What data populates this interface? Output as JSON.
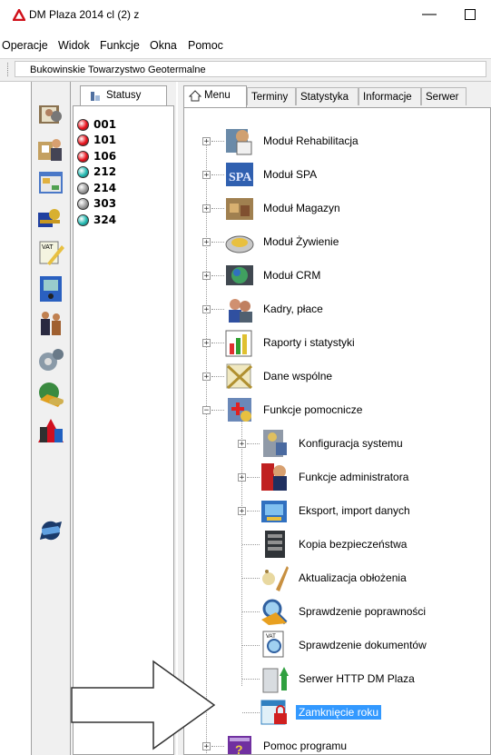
{
  "window": {
    "title": "DM Plaza 2014 cl (2) z",
    "minimize": "—"
  },
  "menu": [
    "Operacje",
    "Widok",
    "Funkcje",
    "Okna",
    "Pomoc"
  ],
  "toolbar": {
    "company": "Bukowinskie Towarzystwo Geotermalne"
  },
  "sidebar": {
    "icons": [
      "book-users-icon",
      "people-group-icon",
      "window-form-icon",
      "key-icon",
      "vat-pencil-icon",
      "phone-card-icon",
      "people-meeting-icon",
      "gears-icon",
      "globe-phone-icon",
      "dm-logo-icon",
      "sync-arrows-icon"
    ]
  },
  "status_panel": {
    "tab_label": "Statusy",
    "items": [
      {
        "code": "001",
        "color": "#e8101a"
      },
      {
        "code": "101",
        "color": "#e8101a"
      },
      {
        "code": "106",
        "color": "#e8101a"
      },
      {
        "code": "212",
        "color": "#20b8b0"
      },
      {
        "code": "214",
        "color": "#9a9a9a"
      },
      {
        "code": "303",
        "color": "#9a9a9a"
      },
      {
        "code": "324",
        "color": "#20b8b0"
      }
    ]
  },
  "tabs": [
    "Menu",
    "Terminy",
    "Statystyka",
    "Informacje",
    "Serwer"
  ],
  "tree": {
    "top": [
      {
        "label": "Moduł Rehabilitacja",
        "expander": "+",
        "icon": "rehab-icon"
      },
      {
        "label": "Moduł SPA",
        "expander": "+",
        "icon": "spa-icon"
      },
      {
        "label": "Moduł Magazyn",
        "expander": "+",
        "icon": "warehouse-icon"
      },
      {
        "label": "Moduł Żywienie",
        "expander": "+",
        "icon": "food-icon"
      },
      {
        "label": "Moduł CRM",
        "expander": "+",
        "icon": "crm-icon"
      },
      {
        "label": "Kadry, płace",
        "expander": "+",
        "icon": "hr-icon"
      },
      {
        "label": "Raporty i statystyki",
        "expander": "+",
        "icon": "reports-icon"
      },
      {
        "label": "Dane wspólne",
        "expander": "+",
        "icon": "shared-data-icon"
      },
      {
        "label": "Funkcje pomocnicze",
        "expander": "−",
        "icon": "helper-functions-icon"
      }
    ],
    "children": [
      {
        "label": "Konfiguracja systemu",
        "expander": "+",
        "icon": "config-icon"
      },
      {
        "label": "Funkcje administratora",
        "expander": "+",
        "icon": "admin-icon"
      },
      {
        "label": "Eksport, import danych",
        "expander": "+",
        "icon": "export-import-icon"
      },
      {
        "label": "Kopia bezpieczeństwa",
        "expander": "",
        "icon": "backup-icon"
      },
      {
        "label": "Aktualizacja obłożenia",
        "expander": "",
        "icon": "occupancy-icon"
      },
      {
        "label": "Sprawdzenie poprawności",
        "expander": "",
        "icon": "validation-icon"
      },
      {
        "label": "Sprawdzenie dokumentów",
        "expander": "",
        "icon": "document-check-icon"
      },
      {
        "label": "Serwer HTTP DM Plaza",
        "expander": "",
        "icon": "http-server-icon"
      },
      {
        "label": "Zamknięcie roku",
        "expander": "",
        "icon": "year-close-icon",
        "selected": true
      }
    ],
    "last": {
      "label": "Pomoc programu",
      "expander": "+",
      "icon": "help-book-icon"
    }
  }
}
